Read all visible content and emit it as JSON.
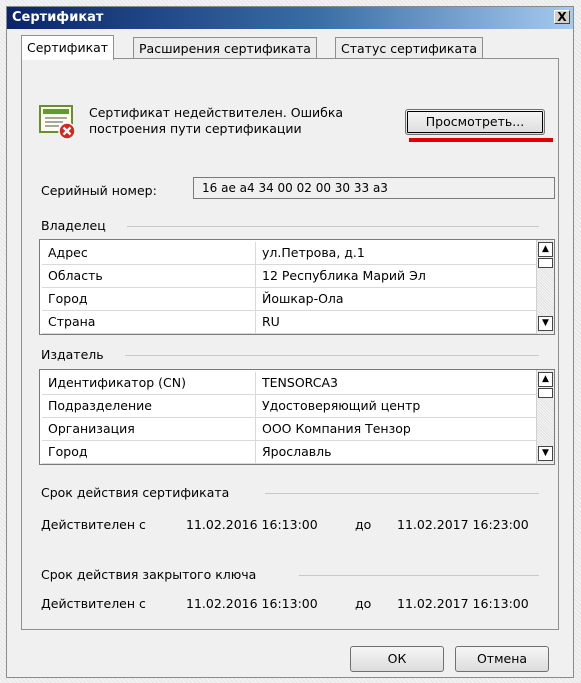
{
  "window": {
    "title": "Сертификат",
    "close_label": "X"
  },
  "tabs": [
    {
      "label": "Сертификат"
    },
    {
      "label": "Расширения сертификата"
    },
    {
      "label": "Статус сертификата"
    }
  ],
  "status": {
    "icon": "certificate-error-icon",
    "message_line1": "Сертификат недействителен. Ошибка",
    "message_line2": "построения пути сертификации",
    "view_button": "Просмотреть..."
  },
  "serial": {
    "label": "Серийный номер:",
    "value": "16 ae a4 34 00 02 00 30 33 a3"
  },
  "owner": {
    "label": "Владелец",
    "rows": [
      {
        "key": "Адрес",
        "value": "ул.Петрова, д.1"
      },
      {
        "key": "Область",
        "value": "12 Республика Марий Эл"
      },
      {
        "key": "Город",
        "value": "Йошкар-Ола"
      },
      {
        "key": "Страна",
        "value": "RU"
      }
    ]
  },
  "issuer": {
    "label": "Издатель",
    "rows": [
      {
        "key": "Идентификатор (CN)",
        "value": "TENSORCA3"
      },
      {
        "key": "Подразделение",
        "value": "Удостоверяющий центр"
      },
      {
        "key": "Организация",
        "value": "ООО Компания Тензор"
      },
      {
        "key": "Город",
        "value": "Ярославль"
      }
    ]
  },
  "cert_validity": {
    "label": "Срок действия сертификата",
    "from_label": "Действителен с",
    "from": "11.02.2016 16:13:00",
    "to_label": "до",
    "to": "11.02.2017 16:23:00"
  },
  "key_validity": {
    "label": "Срок действия закрытого ключа",
    "from_label": "Действителен с",
    "from": "11.02.2016 16:13:00",
    "to_label": "до",
    "to": "11.02.2017 16:13:00"
  },
  "buttons": {
    "ok": "ОК",
    "cancel": "Отмена"
  },
  "colors": {
    "title_bar": "#0a246a",
    "highlight": "#e00000"
  }
}
